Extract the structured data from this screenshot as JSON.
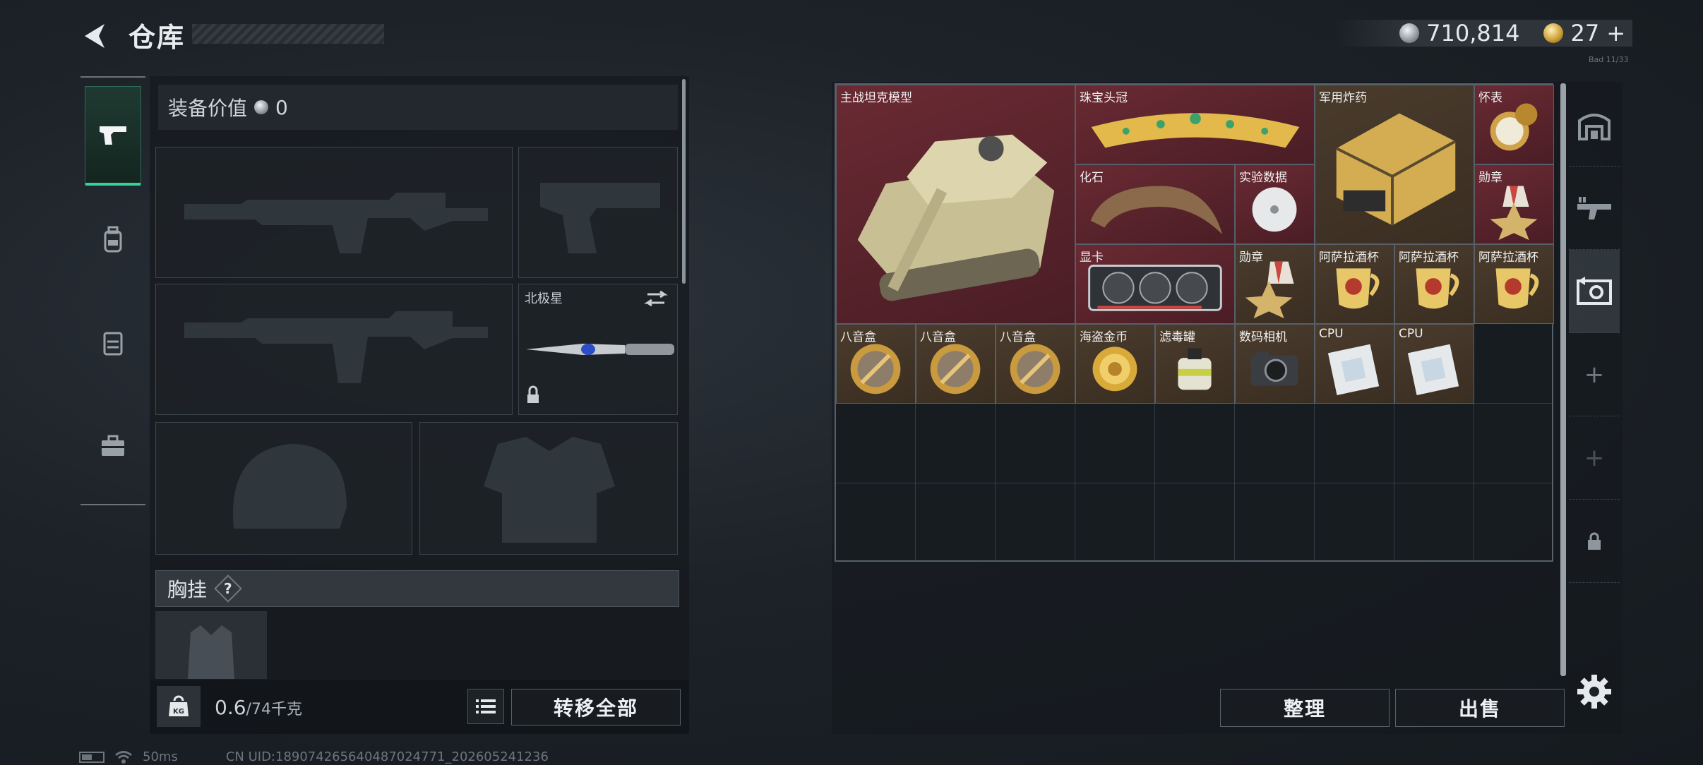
{
  "header": {
    "title": "仓库"
  },
  "currency": {
    "coins": "710,814",
    "tickets": "27",
    "tickets_plus": "+"
  },
  "header_code": "Bad 11/33",
  "left_tabs": [
    "pistol-icon",
    "backpack-icon",
    "rig-icon",
    "toolbox-icon"
  ],
  "equipment": {
    "value_label": "装备价值",
    "value": "0",
    "melee_name": "北极星",
    "chest_label": "胸挂",
    "chest_help": "?"
  },
  "weight": {
    "current": "0.6",
    "max": "/74",
    "unit": "千克",
    "kg_label": "KG"
  },
  "buttons": {
    "transfer_all": "转移全部",
    "sort": "整理",
    "sell": "出售"
  },
  "items": [
    {
      "id": "tank",
      "label": "主战坦克模型",
      "color": "red"
    },
    {
      "id": "tiara",
      "label": "珠宝头冠",
      "color": "red"
    },
    {
      "id": "explosives",
      "label": "军用炸药",
      "color": "brown"
    },
    {
      "id": "watch",
      "label": "怀表",
      "color": "red"
    },
    {
      "id": "fossil",
      "label": "化石",
      "color": "red"
    },
    {
      "id": "data-disc",
      "label": "实验数据",
      "color": "red"
    },
    {
      "id": "medal1",
      "label": "勋章",
      "color": "red"
    },
    {
      "id": "gpu",
      "label": "显卡",
      "color": "red"
    },
    {
      "id": "medal2",
      "label": "勋章",
      "color": "brown"
    },
    {
      "id": "cup1",
      "label": "阿萨拉酒杯",
      "color": "brown"
    },
    {
      "id": "cup2",
      "label": "阿萨拉酒杯",
      "color": "brown"
    },
    {
      "id": "cup3",
      "label": "阿萨拉酒杯",
      "color": "brown"
    },
    {
      "id": "musicbox1",
      "label": "八音盒",
      "color": "brown"
    },
    {
      "id": "musicbox2",
      "label": "八音盒",
      "color": "brown"
    },
    {
      "id": "musicbox3",
      "label": "八音盒",
      "color": "brown"
    },
    {
      "id": "gold-coin",
      "label": "海盗金币",
      "color": "brown"
    },
    {
      "id": "filter",
      "label": "滤毒罐",
      "color": "brown"
    },
    {
      "id": "camera",
      "label": "数码相机",
      "color": "brown"
    },
    {
      "id": "cpu1",
      "label": "CPU",
      "color": "brown"
    },
    {
      "id": "cpu2",
      "label": "CPU",
      "color": "brown"
    }
  ],
  "colors": {
    "accent_green": "#35d39b",
    "item_red": "#6a2a33",
    "item_brown": "#4a3b2c"
  },
  "footer": {
    "ping": "50ms",
    "uid": "CN UID:18907426564048702477​1_202605241236"
  }
}
